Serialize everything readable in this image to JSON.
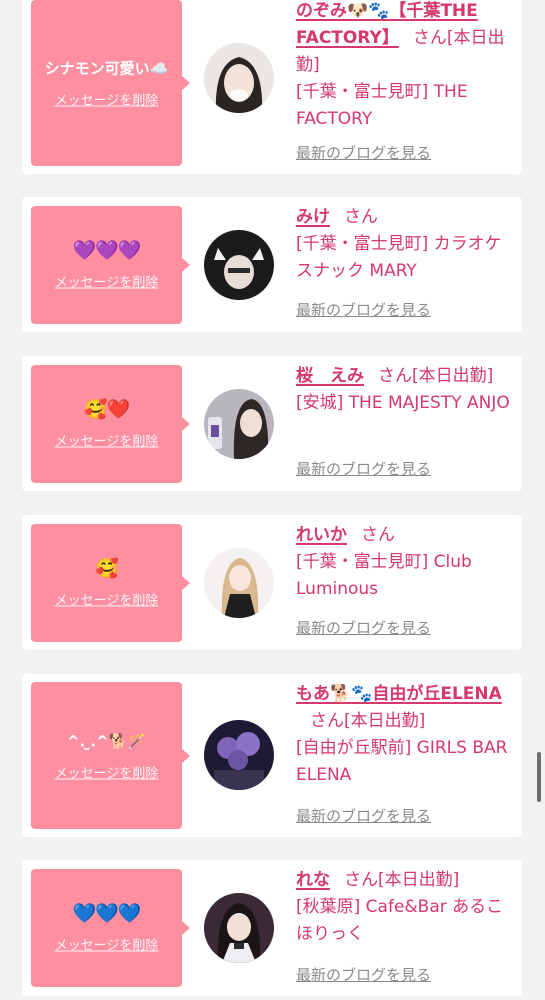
{
  "delete_label": "メッセージを削除",
  "blog_label": "最新のブログを見る",
  "cards": [
    {
      "message": "シナモン可愛い☁️",
      "name": "のぞみ🐶🐾【千葉THE FACTORY】",
      "san": "さん",
      "today": "[本日出勤]",
      "shop": "[千葉・富士見町] THE FACTORY",
      "avatar": "avatar-photo"
    },
    {
      "message": "💜💜💜",
      "name": "みけ",
      "san": "さん",
      "today": "",
      "shop": "[千葉・富士見町] カラオケスナック MARY",
      "avatar": "avatar-photo"
    },
    {
      "message": "🥰❤️",
      "name": "桜　えみ",
      "san": "さん",
      "today": "[本日出勤]",
      "shop": "[安城] THE MAJESTY ANJO",
      "avatar": "avatar-photo"
    },
    {
      "message": "🥰",
      "name": "れいか",
      "san": "さん",
      "today": "",
      "shop": "[千葉・富士見町] Club Luminous",
      "avatar": "avatar-photo"
    },
    {
      "message": "^. ̫.^🐕🪄",
      "name": "もあ🐕🐾自由が丘ELENA",
      "san": "さん",
      "today": "[本日出勤]",
      "shop": "[自由が丘駅前] GIRLS BAR ELENA",
      "avatar": "avatar-photo"
    },
    {
      "message": "💙💙💙",
      "name": "れな",
      "san": "さん",
      "today": "[本日出勤]",
      "shop": "[秋葉原] Cafe&Bar あるこほりっく",
      "avatar": "avatar-photo"
    }
  ]
}
